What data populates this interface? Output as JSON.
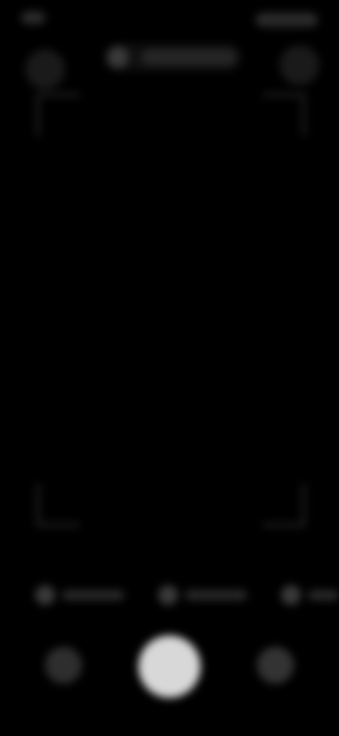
{
  "theme": {
    "background": "#000000",
    "shutter": "#d8d8d8",
    "muted": "#2a2a2a"
  },
  "status_bar": {
    "left_icon": "status-indicator-icon",
    "right_icons": "status-icons"
  },
  "top_bar": {
    "left_control_icon": "settings-icon",
    "right_control_icon": "flash-icon",
    "mode_pill": {
      "icon": "mode-indicator-icon",
      "label": ""
    }
  },
  "viewfinder": {
    "corner_icons": [
      "bracket-top-left-icon",
      "bracket-top-right-icon",
      "bracket-bottom-left-icon",
      "bracket-bottom-right-icon"
    ]
  },
  "mode_row": {
    "options": [
      {
        "icon": "mode-option-icon",
        "label": ""
      },
      {
        "icon": "mode-option-icon",
        "label": ""
      },
      {
        "icon": "mode-option-icon",
        "label": ""
      }
    ]
  },
  "bottom_controls": {
    "gallery_icon": "gallery-thumbnail-icon",
    "shutter_icon": "shutter-icon",
    "flip_icon": "camera-flip-icon"
  }
}
